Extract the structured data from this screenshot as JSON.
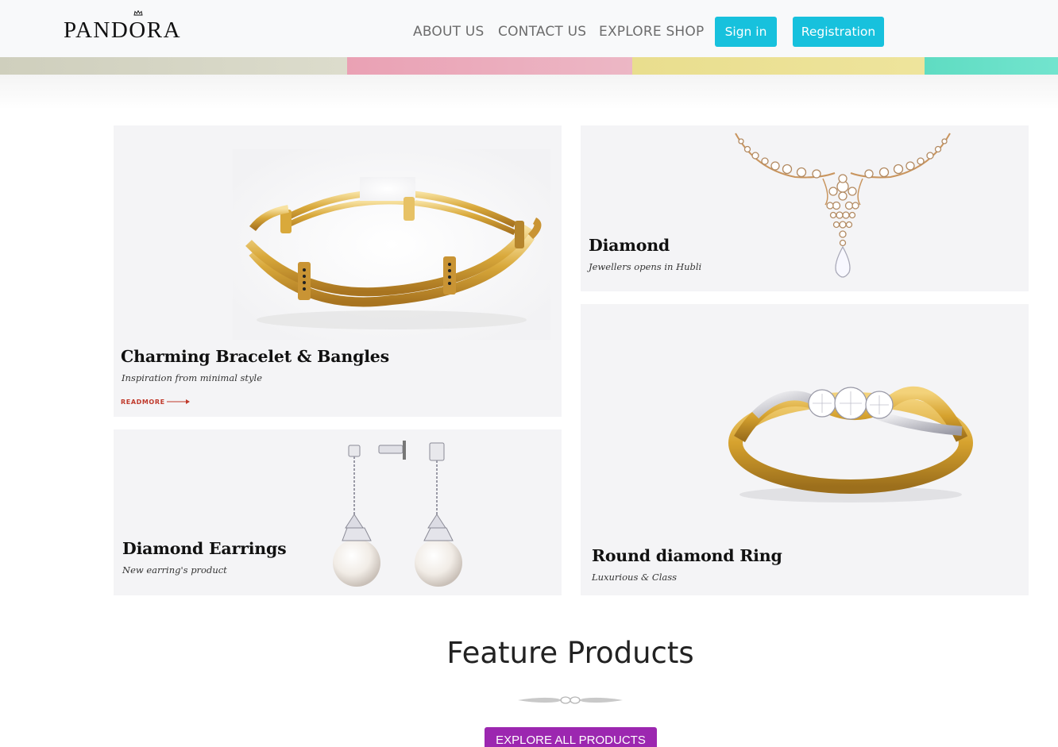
{
  "brand": {
    "name": "PAND",
    "name_o": "O",
    "name_end": "RA"
  },
  "nav": {
    "about": "ABOUT US",
    "contact": "CONTACT US",
    "shop": "EXPLORE SHOP",
    "signin": "Sign in",
    "register": "Registration"
  },
  "colors": {
    "accent": "#17c1dd",
    "purple": "#9c27b0",
    "stripe_beige": "#d6d6c4",
    "stripe_pink": "#eaa5b7",
    "stripe_yellow": "#ece294",
    "stripe_teal": "#65dfc6"
  },
  "cards": {
    "bracelet": {
      "title": "Charming Bracelet & Bangles",
      "subtitle": "Inspiration from minimal style",
      "link": "READMORE"
    },
    "diamond": {
      "title": "Diamond",
      "subtitle": "Jewellers opens in Hubli"
    },
    "earrings": {
      "title": "Diamond Earrings",
      "subtitle": "New earring's product"
    },
    "ring": {
      "title": "Round diamond Ring",
      "subtitle": "Luxurious & Class"
    }
  },
  "feature": {
    "title": "Feature Products",
    "button": "EXPLORE ALL PRODUCTS"
  }
}
